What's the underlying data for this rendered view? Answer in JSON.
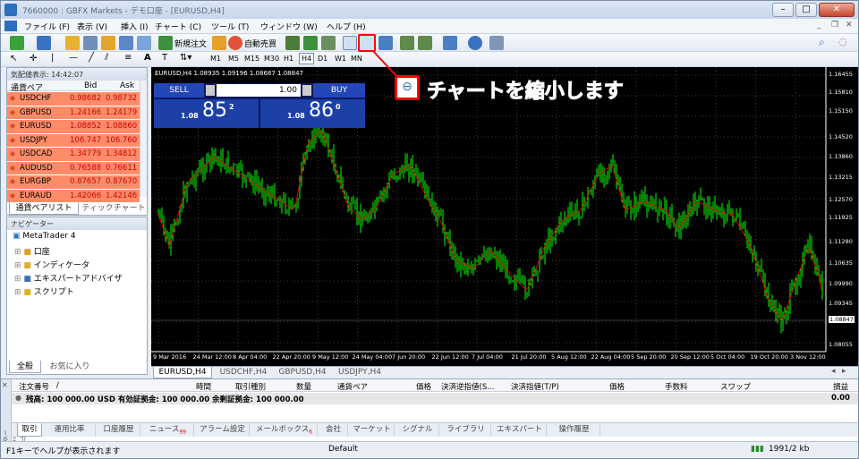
{
  "window": {
    "title": "7660000 : GBFX Markets - デモ口座 - [EURUSD,H4]",
    "title_short": "[EURUSD,H4]"
  },
  "menu": [
    "ファイル (F)",
    "表示 (V)",
    "挿入 (I)",
    "チャート (C)",
    "ツール (T)",
    "ウィンドウ (W)",
    "ヘルプ (H)"
  ],
  "toolbar": {
    "new_order": "新規注文",
    "auto_trade": "自動売買"
  },
  "timeframes": [
    "M1",
    "M5",
    "M15",
    "M30",
    "H1",
    "H4",
    "D1",
    "W1",
    "MN"
  ],
  "market_watch": {
    "header": "気配値表示: 14:42:07",
    "columns": [
      "通貨ペア",
      "Bid",
      "Ask"
    ],
    "rows": [
      {
        "symbol": "USDCHF",
        "bid": "0.98682",
        "ask": "0.98732"
      },
      {
        "symbol": "GBPUSD",
        "bid": "1.24166",
        "ask": "1.24179"
      },
      {
        "symbol": "EURUSD",
        "bid": "1.08852",
        "ask": "1.08860"
      },
      {
        "symbol": "USDJPY",
        "bid": "106.747",
        "ask": "106.760"
      },
      {
        "symbol": "USDCAD",
        "bid": "1.34779",
        "ask": "1.34812"
      },
      {
        "symbol": "AUDUSD",
        "bid": "0.76588",
        "ask": "0.76611"
      },
      {
        "symbol": "EURGBP",
        "bid": "0.87657",
        "ask": "0.87670"
      },
      {
        "symbol": "EURAUD",
        "bid": "1.42066",
        "ask": "1.42146"
      }
    ],
    "tabs": [
      "通貨ペアリスト",
      "ティックチャート"
    ]
  },
  "navigator": {
    "header": "ナビゲーター",
    "root": "MetaTrader 4",
    "items": [
      "口座",
      "インディケータ",
      "エキスパートアドバイザ",
      "スクリプト"
    ],
    "tabs": [
      "全般",
      "お気に入り"
    ]
  },
  "chart": {
    "info": "EURUSD,H4 1.08935 1.09196 1.08687 1.08847",
    "one_click": {
      "sell": "SELL",
      "buy": "BUY",
      "lots": "1.00",
      "sell_prefix": "1.08",
      "sell_big": "85",
      "sell_sup": "2",
      "buy_prefix": "1.08",
      "buy_big": "86",
      "buy_sup": "0"
    },
    "price_labels": [
      "1.16455",
      "1.15810",
      "1.15150",
      "1.14520",
      "1.13860",
      "1.13215",
      "1.12570",
      "1.11925",
      "1.11280",
      "1.10635",
      "1.09990",
      "1.09345",
      "1.08847",
      "1.08055"
    ],
    "current_price": "1.08847",
    "time_labels": [
      "9 Mar 2016",
      "24 Mar 12:00",
      "8 Apr 04:00",
      "22 Apr 20:00",
      "9 May 12:00",
      "24 May 04:00",
      "7 Jun 20:00",
      "22 Jun 12:00",
      "7 Jul 04:00",
      "21 Jul 20:00",
      "5 Aug 12:00",
      "22 Aug 04:00",
      "5 Sep 20:00",
      "20 Sep 12:00",
      "5 Oct 04:00",
      "19 Oct 20:00",
      "3 Nov 12:00"
    ],
    "tabs": [
      "EURUSD,H4",
      "USDCHF,H4",
      "GBPUSD,H4",
      "USDJPY,H4"
    ]
  },
  "callout": {
    "text": "チャートを縮小します"
  },
  "terminal": {
    "side_label": "ターミナル",
    "columns": [
      "注文番号",
      "/",
      "時間",
      "取引種別",
      "数量",
      "通貨ペア",
      "価格",
      "決済逆指値(S...",
      "決済指値(T/P)",
      "価格",
      "手数料",
      "スワップ",
      "損益"
    ],
    "balance_text": "残高: 100 000.00 USD  有効証拠金: 100 000.00  余剰証拠金: 100 000.00",
    "balance_value": "0.00",
    "tabs": [
      {
        "label": "取引"
      },
      {
        "label": "運用比率"
      },
      {
        "label": "口座履歴"
      },
      {
        "label": "ニュース",
        "badge": "99"
      },
      {
        "label": "アラーム設定"
      },
      {
        "label": "メールボックス",
        "badge": "6"
      },
      {
        "label": "会社"
      },
      {
        "label": "マーケット"
      },
      {
        "label": "シグナル"
      },
      {
        "label": "ライブラリ"
      },
      {
        "label": "エキスパート"
      },
      {
        "label": "操作履歴"
      }
    ]
  },
  "status": {
    "help": "F1キーでヘルプが表示されます",
    "profile": "Default",
    "traffic": "1991/2 kb"
  },
  "colors": {
    "bid_row": "#ff8c69",
    "chart_bg": "#000000",
    "candle": "#00ff00",
    "ma": "#ff0000",
    "oneclick": "#1c3fa8",
    "highlight": "#ff0000"
  }
}
